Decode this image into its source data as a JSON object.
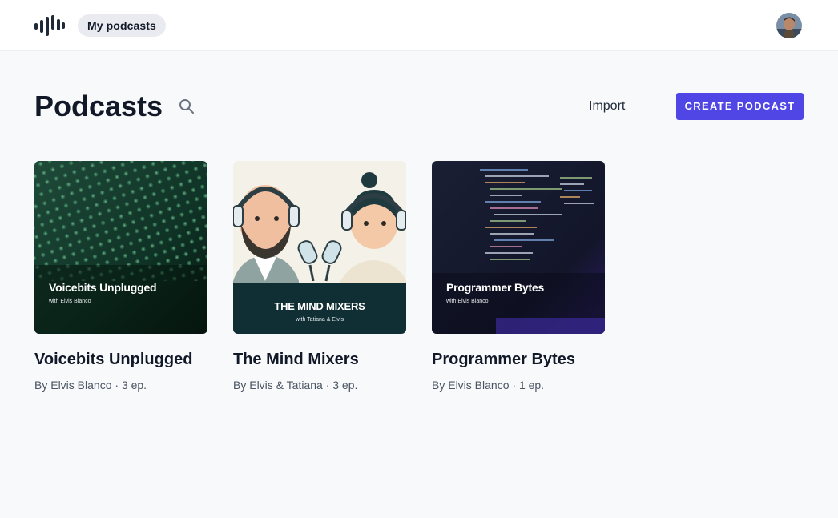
{
  "nav": {
    "logo": "soundwave-logo",
    "my_podcasts": "My podcasts",
    "avatar": "user-avatar"
  },
  "header": {
    "title": "Podcasts",
    "import_label": "Import",
    "create_label": "CREATE PODCAST"
  },
  "colors": {
    "accent": "#4f46e5",
    "background": "#f8f9fb"
  },
  "podcasts": [
    {
      "title": "Voicebits Unplugged",
      "cover_title": "Voicebits Unplugged",
      "cover_subtitle": "with Elvis Blanco",
      "author": "By Elvis Blanco",
      "separator": "·",
      "episodes": "3 ep."
    },
    {
      "title": "The Mind Mixers",
      "cover_title": "THE MIND MIXERS",
      "cover_subtitle": "with Tatiana & Elvis",
      "author": "By Elvis & Tatiana",
      "separator": "·",
      "episodes": "3 ep."
    },
    {
      "title": "Programmer Bytes",
      "cover_title": "Programmer Bytes",
      "cover_subtitle": "with Elvis Blanco",
      "author": "By Elvis Blanco",
      "separator": "·",
      "episodes": "1 ep."
    }
  ]
}
